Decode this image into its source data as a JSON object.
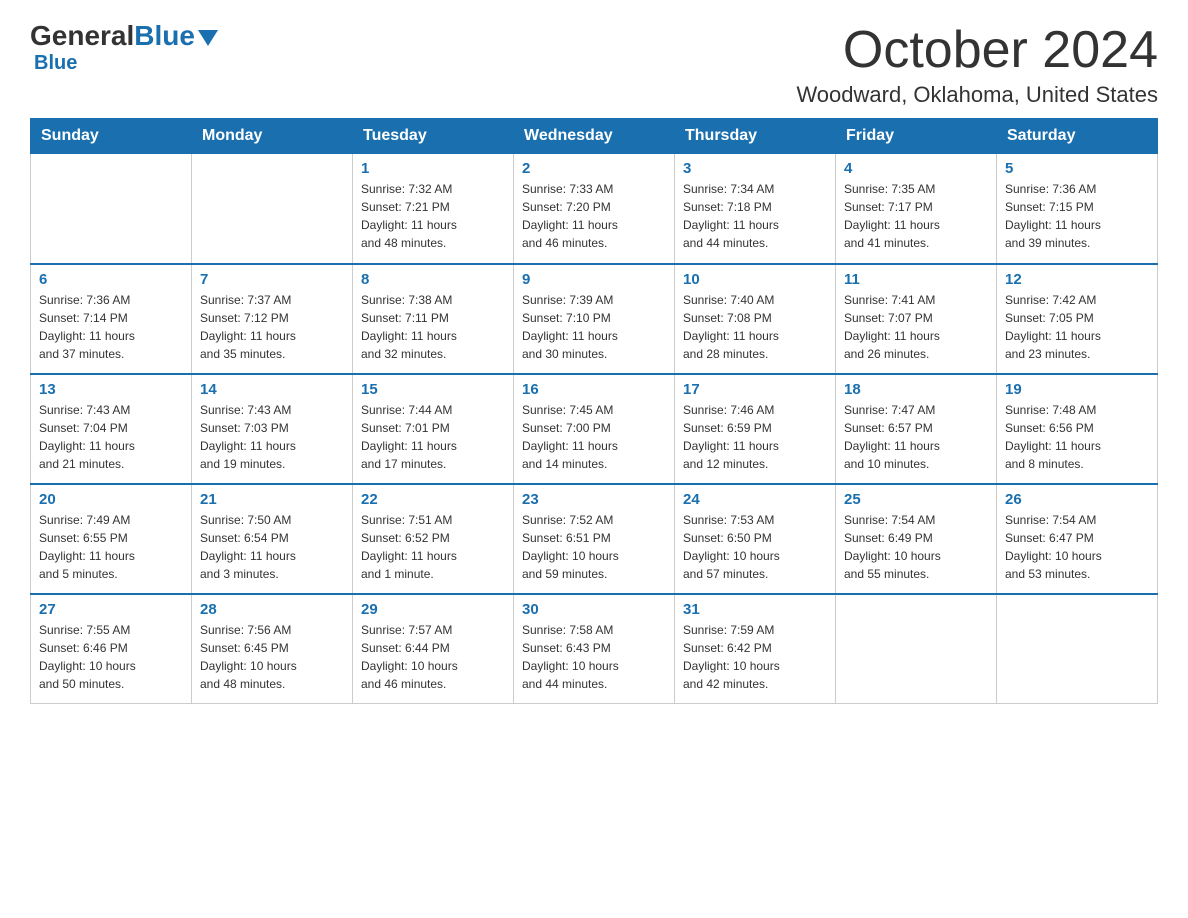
{
  "header": {
    "logo_general": "General",
    "logo_blue": "Blue",
    "month_title": "October 2024",
    "location": "Woodward, Oklahoma, United States"
  },
  "days_of_week": [
    "Sunday",
    "Monday",
    "Tuesday",
    "Wednesday",
    "Thursday",
    "Friday",
    "Saturday"
  ],
  "weeks": [
    [
      {
        "day": "",
        "info": ""
      },
      {
        "day": "",
        "info": ""
      },
      {
        "day": "1",
        "info": "Sunrise: 7:32 AM\nSunset: 7:21 PM\nDaylight: 11 hours\nand 48 minutes."
      },
      {
        "day": "2",
        "info": "Sunrise: 7:33 AM\nSunset: 7:20 PM\nDaylight: 11 hours\nand 46 minutes."
      },
      {
        "day": "3",
        "info": "Sunrise: 7:34 AM\nSunset: 7:18 PM\nDaylight: 11 hours\nand 44 minutes."
      },
      {
        "day": "4",
        "info": "Sunrise: 7:35 AM\nSunset: 7:17 PM\nDaylight: 11 hours\nand 41 minutes."
      },
      {
        "day": "5",
        "info": "Sunrise: 7:36 AM\nSunset: 7:15 PM\nDaylight: 11 hours\nand 39 minutes."
      }
    ],
    [
      {
        "day": "6",
        "info": "Sunrise: 7:36 AM\nSunset: 7:14 PM\nDaylight: 11 hours\nand 37 minutes."
      },
      {
        "day": "7",
        "info": "Sunrise: 7:37 AM\nSunset: 7:12 PM\nDaylight: 11 hours\nand 35 minutes."
      },
      {
        "day": "8",
        "info": "Sunrise: 7:38 AM\nSunset: 7:11 PM\nDaylight: 11 hours\nand 32 minutes."
      },
      {
        "day": "9",
        "info": "Sunrise: 7:39 AM\nSunset: 7:10 PM\nDaylight: 11 hours\nand 30 minutes."
      },
      {
        "day": "10",
        "info": "Sunrise: 7:40 AM\nSunset: 7:08 PM\nDaylight: 11 hours\nand 28 minutes."
      },
      {
        "day": "11",
        "info": "Sunrise: 7:41 AM\nSunset: 7:07 PM\nDaylight: 11 hours\nand 26 minutes."
      },
      {
        "day": "12",
        "info": "Sunrise: 7:42 AM\nSunset: 7:05 PM\nDaylight: 11 hours\nand 23 minutes."
      }
    ],
    [
      {
        "day": "13",
        "info": "Sunrise: 7:43 AM\nSunset: 7:04 PM\nDaylight: 11 hours\nand 21 minutes."
      },
      {
        "day": "14",
        "info": "Sunrise: 7:43 AM\nSunset: 7:03 PM\nDaylight: 11 hours\nand 19 minutes."
      },
      {
        "day": "15",
        "info": "Sunrise: 7:44 AM\nSunset: 7:01 PM\nDaylight: 11 hours\nand 17 minutes."
      },
      {
        "day": "16",
        "info": "Sunrise: 7:45 AM\nSunset: 7:00 PM\nDaylight: 11 hours\nand 14 minutes."
      },
      {
        "day": "17",
        "info": "Sunrise: 7:46 AM\nSunset: 6:59 PM\nDaylight: 11 hours\nand 12 minutes."
      },
      {
        "day": "18",
        "info": "Sunrise: 7:47 AM\nSunset: 6:57 PM\nDaylight: 11 hours\nand 10 minutes."
      },
      {
        "day": "19",
        "info": "Sunrise: 7:48 AM\nSunset: 6:56 PM\nDaylight: 11 hours\nand 8 minutes."
      }
    ],
    [
      {
        "day": "20",
        "info": "Sunrise: 7:49 AM\nSunset: 6:55 PM\nDaylight: 11 hours\nand 5 minutes."
      },
      {
        "day": "21",
        "info": "Sunrise: 7:50 AM\nSunset: 6:54 PM\nDaylight: 11 hours\nand 3 minutes."
      },
      {
        "day": "22",
        "info": "Sunrise: 7:51 AM\nSunset: 6:52 PM\nDaylight: 11 hours\nand 1 minute."
      },
      {
        "day": "23",
        "info": "Sunrise: 7:52 AM\nSunset: 6:51 PM\nDaylight: 10 hours\nand 59 minutes."
      },
      {
        "day": "24",
        "info": "Sunrise: 7:53 AM\nSunset: 6:50 PM\nDaylight: 10 hours\nand 57 minutes."
      },
      {
        "day": "25",
        "info": "Sunrise: 7:54 AM\nSunset: 6:49 PM\nDaylight: 10 hours\nand 55 minutes."
      },
      {
        "day": "26",
        "info": "Sunrise: 7:54 AM\nSunset: 6:47 PM\nDaylight: 10 hours\nand 53 minutes."
      }
    ],
    [
      {
        "day": "27",
        "info": "Sunrise: 7:55 AM\nSunset: 6:46 PM\nDaylight: 10 hours\nand 50 minutes."
      },
      {
        "day": "28",
        "info": "Sunrise: 7:56 AM\nSunset: 6:45 PM\nDaylight: 10 hours\nand 48 minutes."
      },
      {
        "day": "29",
        "info": "Sunrise: 7:57 AM\nSunset: 6:44 PM\nDaylight: 10 hours\nand 46 minutes."
      },
      {
        "day": "30",
        "info": "Sunrise: 7:58 AM\nSunset: 6:43 PM\nDaylight: 10 hours\nand 44 minutes."
      },
      {
        "day": "31",
        "info": "Sunrise: 7:59 AM\nSunset: 6:42 PM\nDaylight: 10 hours\nand 42 minutes."
      },
      {
        "day": "",
        "info": ""
      },
      {
        "day": "",
        "info": ""
      }
    ]
  ]
}
